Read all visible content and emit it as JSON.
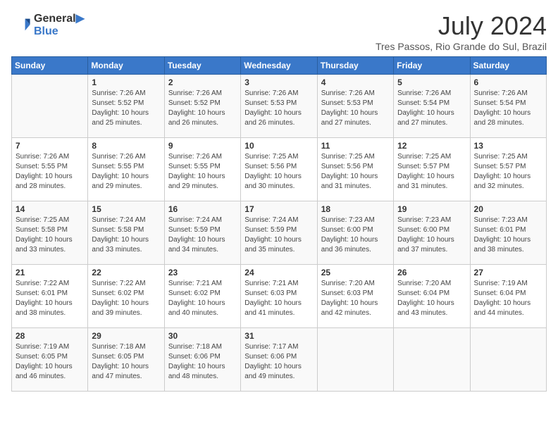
{
  "header": {
    "logo_line1": "General",
    "logo_line2": "Blue",
    "month_year": "July 2024",
    "location": "Tres Passos, Rio Grande do Sul, Brazil"
  },
  "days_of_week": [
    "Sunday",
    "Monday",
    "Tuesday",
    "Wednesday",
    "Thursday",
    "Friday",
    "Saturday"
  ],
  "weeks": [
    [
      {
        "day": "",
        "info": ""
      },
      {
        "day": "1",
        "info": "Sunrise: 7:26 AM\nSunset: 5:52 PM\nDaylight: 10 hours\nand 25 minutes."
      },
      {
        "day": "2",
        "info": "Sunrise: 7:26 AM\nSunset: 5:52 PM\nDaylight: 10 hours\nand 26 minutes."
      },
      {
        "day": "3",
        "info": "Sunrise: 7:26 AM\nSunset: 5:53 PM\nDaylight: 10 hours\nand 26 minutes."
      },
      {
        "day": "4",
        "info": "Sunrise: 7:26 AM\nSunset: 5:53 PM\nDaylight: 10 hours\nand 27 minutes."
      },
      {
        "day": "5",
        "info": "Sunrise: 7:26 AM\nSunset: 5:54 PM\nDaylight: 10 hours\nand 27 minutes."
      },
      {
        "day": "6",
        "info": "Sunrise: 7:26 AM\nSunset: 5:54 PM\nDaylight: 10 hours\nand 28 minutes."
      }
    ],
    [
      {
        "day": "7",
        "info": "Sunrise: 7:26 AM\nSunset: 5:55 PM\nDaylight: 10 hours\nand 28 minutes."
      },
      {
        "day": "8",
        "info": "Sunrise: 7:26 AM\nSunset: 5:55 PM\nDaylight: 10 hours\nand 29 minutes."
      },
      {
        "day": "9",
        "info": "Sunrise: 7:26 AM\nSunset: 5:55 PM\nDaylight: 10 hours\nand 29 minutes."
      },
      {
        "day": "10",
        "info": "Sunrise: 7:25 AM\nSunset: 5:56 PM\nDaylight: 10 hours\nand 30 minutes."
      },
      {
        "day": "11",
        "info": "Sunrise: 7:25 AM\nSunset: 5:56 PM\nDaylight: 10 hours\nand 31 minutes."
      },
      {
        "day": "12",
        "info": "Sunrise: 7:25 AM\nSunset: 5:57 PM\nDaylight: 10 hours\nand 31 minutes."
      },
      {
        "day": "13",
        "info": "Sunrise: 7:25 AM\nSunset: 5:57 PM\nDaylight: 10 hours\nand 32 minutes."
      }
    ],
    [
      {
        "day": "14",
        "info": "Sunrise: 7:25 AM\nSunset: 5:58 PM\nDaylight: 10 hours\nand 33 minutes."
      },
      {
        "day": "15",
        "info": "Sunrise: 7:24 AM\nSunset: 5:58 PM\nDaylight: 10 hours\nand 33 minutes."
      },
      {
        "day": "16",
        "info": "Sunrise: 7:24 AM\nSunset: 5:59 PM\nDaylight: 10 hours\nand 34 minutes."
      },
      {
        "day": "17",
        "info": "Sunrise: 7:24 AM\nSunset: 5:59 PM\nDaylight: 10 hours\nand 35 minutes."
      },
      {
        "day": "18",
        "info": "Sunrise: 7:23 AM\nSunset: 6:00 PM\nDaylight: 10 hours\nand 36 minutes."
      },
      {
        "day": "19",
        "info": "Sunrise: 7:23 AM\nSunset: 6:00 PM\nDaylight: 10 hours\nand 37 minutes."
      },
      {
        "day": "20",
        "info": "Sunrise: 7:23 AM\nSunset: 6:01 PM\nDaylight: 10 hours\nand 38 minutes."
      }
    ],
    [
      {
        "day": "21",
        "info": "Sunrise: 7:22 AM\nSunset: 6:01 PM\nDaylight: 10 hours\nand 38 minutes."
      },
      {
        "day": "22",
        "info": "Sunrise: 7:22 AM\nSunset: 6:02 PM\nDaylight: 10 hours\nand 39 minutes."
      },
      {
        "day": "23",
        "info": "Sunrise: 7:21 AM\nSunset: 6:02 PM\nDaylight: 10 hours\nand 40 minutes."
      },
      {
        "day": "24",
        "info": "Sunrise: 7:21 AM\nSunset: 6:03 PM\nDaylight: 10 hours\nand 41 minutes."
      },
      {
        "day": "25",
        "info": "Sunrise: 7:20 AM\nSunset: 6:03 PM\nDaylight: 10 hours\nand 42 minutes."
      },
      {
        "day": "26",
        "info": "Sunrise: 7:20 AM\nSunset: 6:04 PM\nDaylight: 10 hours\nand 43 minutes."
      },
      {
        "day": "27",
        "info": "Sunrise: 7:19 AM\nSunset: 6:04 PM\nDaylight: 10 hours\nand 44 minutes."
      }
    ],
    [
      {
        "day": "28",
        "info": "Sunrise: 7:19 AM\nSunset: 6:05 PM\nDaylight: 10 hours\nand 46 minutes."
      },
      {
        "day": "29",
        "info": "Sunrise: 7:18 AM\nSunset: 6:05 PM\nDaylight: 10 hours\nand 47 minutes."
      },
      {
        "day": "30",
        "info": "Sunrise: 7:18 AM\nSunset: 6:06 PM\nDaylight: 10 hours\nand 48 minutes."
      },
      {
        "day": "31",
        "info": "Sunrise: 7:17 AM\nSunset: 6:06 PM\nDaylight: 10 hours\nand 49 minutes."
      },
      {
        "day": "",
        "info": ""
      },
      {
        "day": "",
        "info": ""
      },
      {
        "day": "",
        "info": ""
      }
    ]
  ]
}
